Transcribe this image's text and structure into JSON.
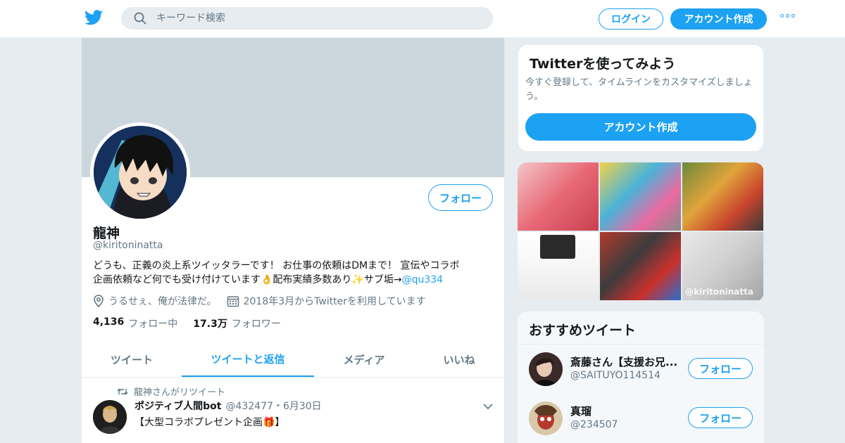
{
  "topbar": {
    "search_placeholder": "キーワード検索",
    "login_label": "ログイン",
    "signup_label": "アカウント作成"
  },
  "profile": {
    "name": "龍神",
    "handle": "@kiritoninatta",
    "bio_line1": "どうも、正義の炎上系ツイッタラーです！ お仕事の依頼はDMまで！ 宣伝やコラボ",
    "bio_line2_pre": "企画依頼など何でも受け付けています👌配布実績多数あり✨サブ垢→",
    "bio_link": "@qu334",
    "location": "うるせぇ、俺が法律だ。",
    "joined": "2018年3月からTwitterを利用しています",
    "following_count": "4,136",
    "following_label": "フォロー中",
    "followers_count": "17.3万",
    "followers_label": "フォロワー",
    "follow_button": "フォロー"
  },
  "tabs": [
    {
      "label": "ツイート"
    },
    {
      "label": "ツイートと返信"
    },
    {
      "label": "メディア"
    },
    {
      "label": "いいね"
    }
  ],
  "tweet": {
    "retweet_note": "龍神さんがリツイート",
    "author": "ポジティブ人間bot",
    "handle_date": "@432477・6月30日",
    "text": "【大型コラボプレゼント企画🎁】"
  },
  "sidebar": {
    "try_title": "Twitterを使ってみよう",
    "try_text": "今すぐ登録して、タイムラインをカスタマイズしましょう。",
    "signup_button": "アカウント作成",
    "photo_watermark": "@kiritoninatta",
    "recommended_title": "おすすめツイート",
    "recommended": [
      {
        "name": "斎藤さん【支援お兄...",
        "handle": "@SAITUYO114514",
        "button": "フォロー"
      },
      {
        "name": "真瑠",
        "handle": "@234507",
        "button": "フォロー"
      }
    ]
  },
  "colors": {
    "accent": "#1da1f2",
    "banner": "#ccd6dd",
    "muted": "#657786"
  }
}
